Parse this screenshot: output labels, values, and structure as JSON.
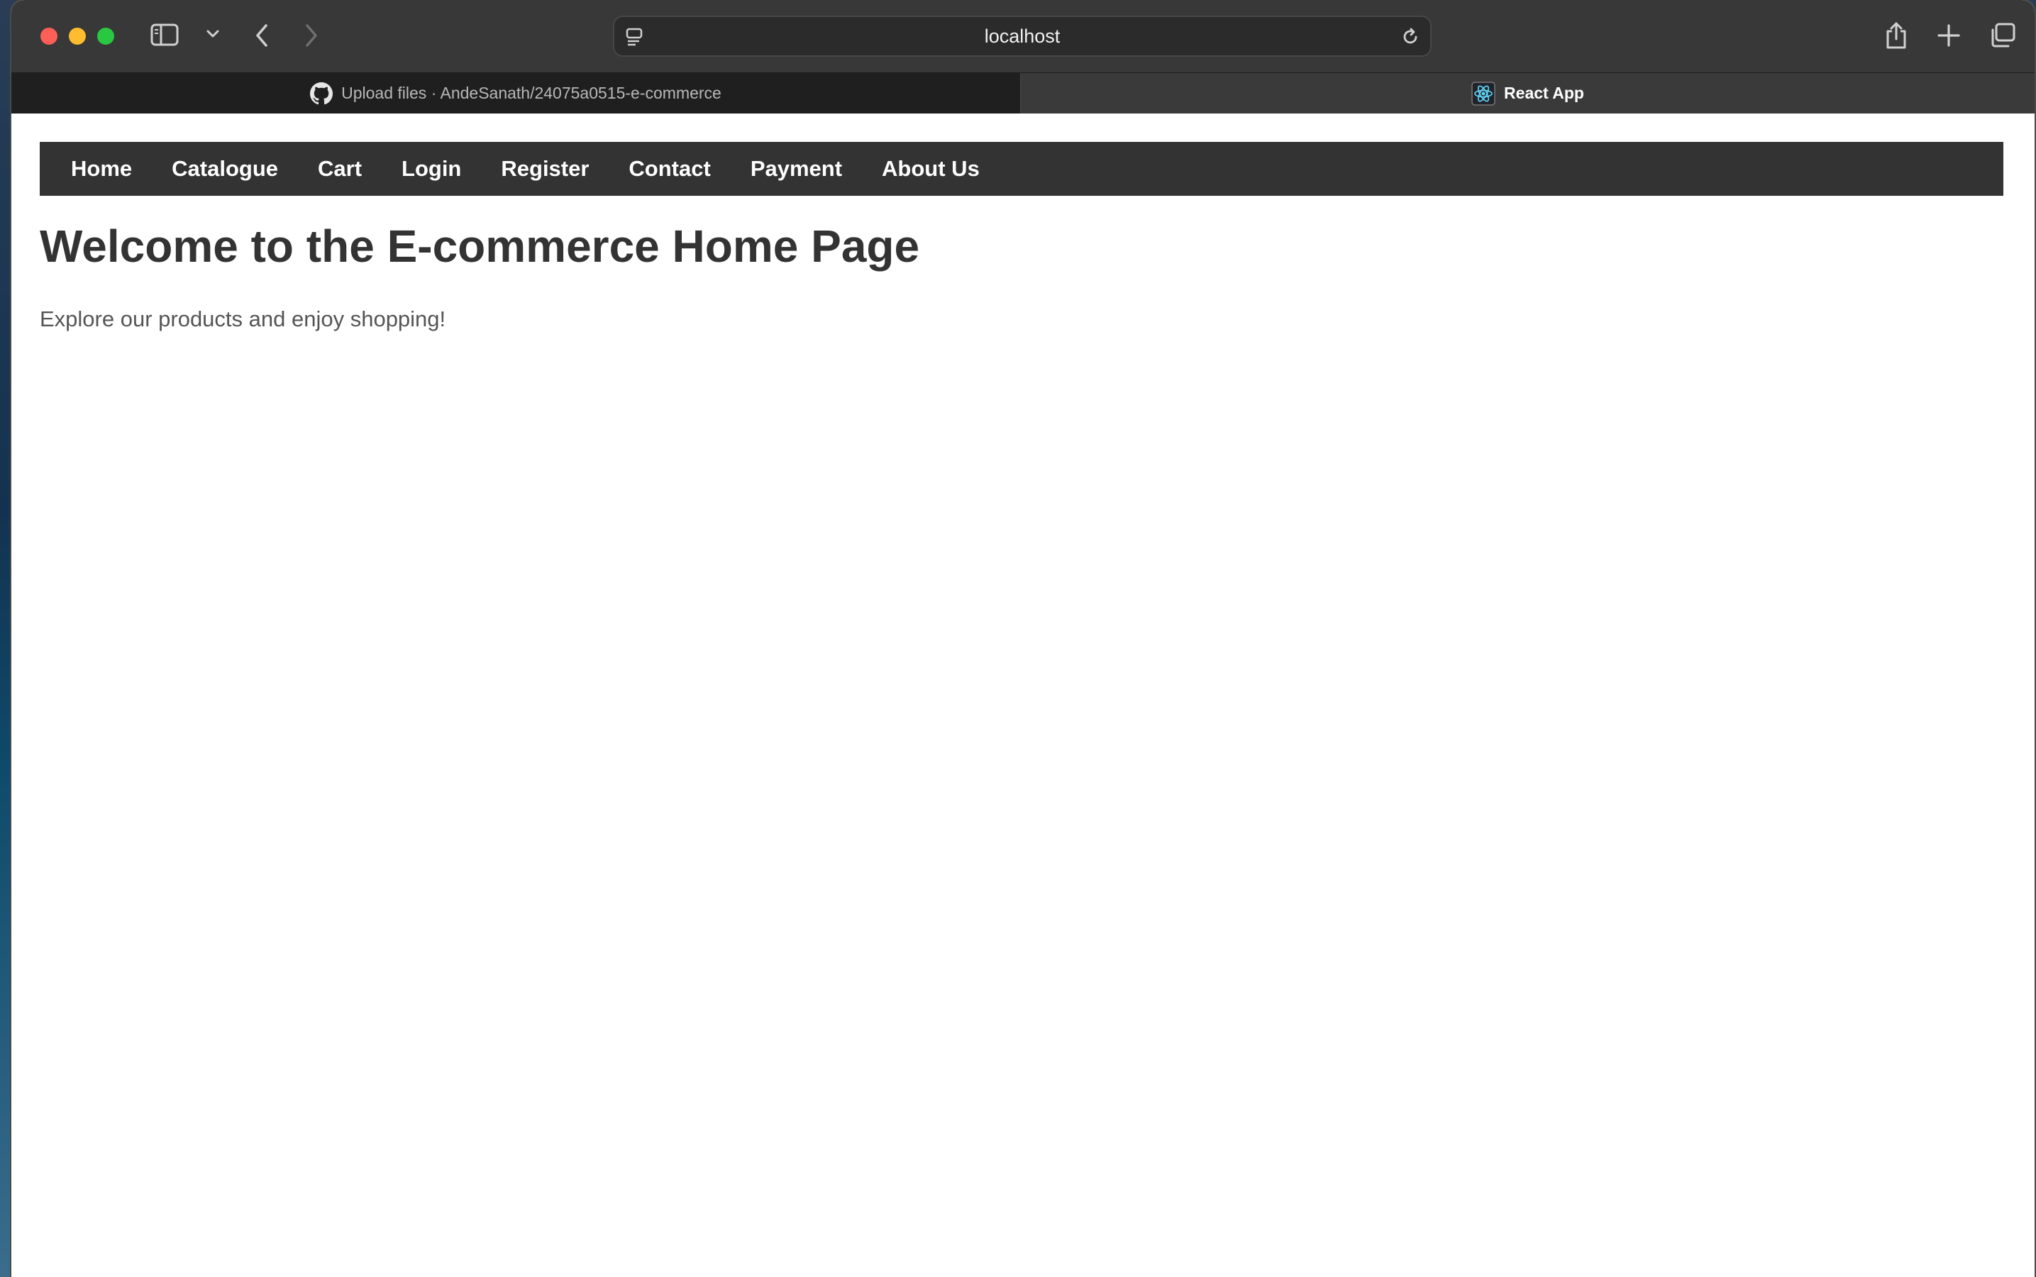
{
  "browser": {
    "url": "localhost",
    "tabs": [
      {
        "title": "Upload files · AndeSanath/24075a0515-e-commerce",
        "favicon": "github-icon",
        "active": false
      },
      {
        "title": "React App",
        "favicon": "react-icon",
        "active": true
      }
    ]
  },
  "navbar": {
    "links": [
      {
        "label": "Home"
      },
      {
        "label": "Catalogue"
      },
      {
        "label": "Cart"
      },
      {
        "label": "Login"
      },
      {
        "label": "Register"
      },
      {
        "label": "Contact"
      },
      {
        "label": "Payment"
      },
      {
        "label": "About Us"
      }
    ],
    "background": "#333333"
  },
  "main": {
    "title": "Welcome to the E-commerce Home Page",
    "subtitle": "Explore our products and enjoy shopping!"
  },
  "colors": {
    "traffic_close": "#ff5f57",
    "traffic_minimize": "#febc2e",
    "traffic_maximize": "#28c840"
  }
}
